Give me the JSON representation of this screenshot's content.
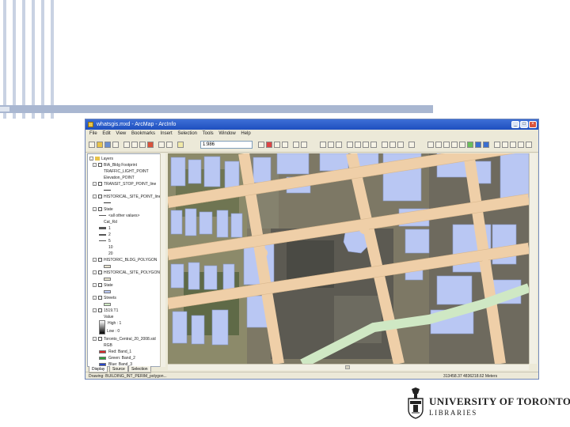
{
  "window": {
    "title": "whatsgis.mxd - ArcMap - ArcInfo",
    "buttons": {
      "minimize": "_",
      "maximize": "□",
      "close": "×"
    }
  },
  "menu": [
    "File",
    "Edit",
    "View",
    "Bookmarks",
    "Insert",
    "Selection",
    "Tools",
    "Window",
    "Help"
  ],
  "toolbar": {
    "scale": "1:986"
  },
  "toc": {
    "root": "Layers",
    "layers": [
      {
        "label": "BIA_Bldg Footprint",
        "checked": true,
        "sub": [
          "TRAFFIC_LIGHT_POINT",
          "Elevation_POINT"
        ]
      },
      {
        "label": "TRANSIT_STOP_POINT_line",
        "checked": true
      },
      {
        "label": "HISTORICAL_SITE_POINT_line",
        "checked": true
      },
      {
        "label": "State",
        "checked": true,
        "sub": [
          "<all other values>",
          "Cat_Rd",
          "1",
          "2",
          "5",
          "10",
          "20"
        ]
      },
      {
        "label": "HISTORIC_BLDG_POLYGON",
        "checked": true
      },
      {
        "label": "HISTORICAL_SITE_POLYGON",
        "checked": true
      },
      {
        "label": "State",
        "checked": true
      },
      {
        "label": "Streets",
        "checked": true
      },
      {
        "label": "1519.T1",
        "checked": true,
        "sub": [
          "Value",
          "High : 1",
          "Low : 0"
        ]
      },
      {
        "label": "Toronto_Central_20_2008.sid",
        "checked": true,
        "sub": [
          "RGB",
          "Red: Band_1",
          "Green: Band_2",
          "Blue: Band_3"
        ]
      }
    ],
    "tabs": [
      "Display",
      "Source",
      "Selection"
    ]
  },
  "status": {
    "left": "Drawing: BUILDING_INT_PERIM_polygon...",
    "coords": "313458.37 4836218.62 Meters"
  },
  "logo": {
    "name": "UNIVERSITY OF TORONTO",
    "sub": "LIBRARIES"
  },
  "colors": {
    "building": "#b9c7f3",
    "road": "#efcfa8",
    "park": "#cfe8c4",
    "titlebar": "#1e4fbf",
    "slide_bar": "#a9b7d1"
  }
}
